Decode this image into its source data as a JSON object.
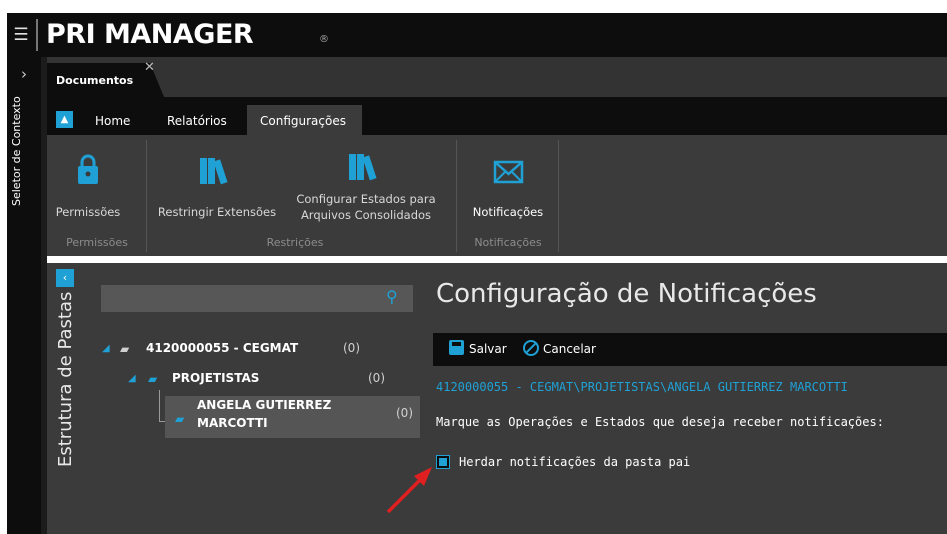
{
  "app": {
    "brand": "PRI MANAGER",
    "registered_mark": "®",
    "menu_icon": "list-icon"
  },
  "rail": {
    "label": "Seletor de Contexto",
    "expand_icon": "chevron-right-icon"
  },
  "doc_tab": {
    "label": "Documentos",
    "close_icon": "close-icon"
  },
  "ribbon": {
    "collapse_icon": "chevron-up-icon",
    "tabs": [
      {
        "label": "Home",
        "active": false
      },
      {
        "label": "Relatórios",
        "active": false
      },
      {
        "label": "Configurações",
        "active": true
      }
    ],
    "groups": [
      {
        "label": "Permissões",
        "buttons": [
          {
            "label": "Permissões",
            "icon": "lock-icon"
          }
        ]
      },
      {
        "label": "Restrições",
        "buttons": [
          {
            "label": "Restringir Extensões",
            "icon": "books-icon"
          },
          {
            "label_line1": "Configurar Estados para",
            "label_line2": "Arquivos Consolidados",
            "icon": "books-icon"
          }
        ]
      },
      {
        "label": "Notificações",
        "buttons": [
          {
            "label": "Notificações",
            "icon": "envelope-icon"
          }
        ]
      }
    ]
  },
  "tree": {
    "panel_label": "Estrutura de Pastas",
    "toggle_icon": "chevron-left-icon",
    "search": {
      "value": "",
      "placeholder": "",
      "icon": "search-icon"
    },
    "nodes": [
      {
        "label": "4120000055 - CEGMAT",
        "count": "(0)"
      },
      {
        "label": "PROJETISTAS",
        "count": "(0)"
      },
      {
        "label_line1": "ANGELA GUTIERREZ",
        "label_line2": "MARCOTTI",
        "count": "(0)",
        "selected": true
      }
    ]
  },
  "content": {
    "title": "Configuração de Notificações",
    "toolbar": {
      "save_label": "Salvar",
      "cancel_label": "Cancelar"
    },
    "breadcrumb": "4120000055 - CEGMAT\\PROJETISTAS\\ANGELA GUTIERREZ MARCOTTI",
    "instructions": "Marque as Operações e Estados que deseja receber notificações:",
    "inherit": {
      "label": "Herdar notificações da pasta pai",
      "checked": true
    }
  },
  "colors": {
    "accent": "#1fa1d6",
    "arrow": "#e02020",
    "dark": "#0d0d0d",
    "panel": "#3b3b3b"
  }
}
